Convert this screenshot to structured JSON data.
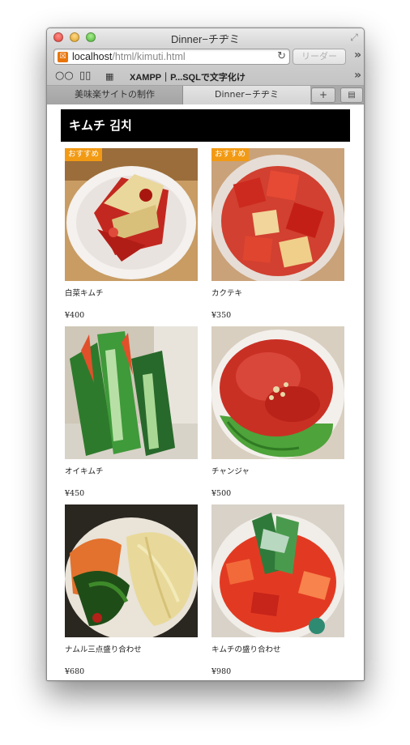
{
  "window": {
    "title": "Dinner−チヂミ"
  },
  "toolbar": {
    "url_host": "localhost",
    "url_path": "/html/kimuti.html",
    "reader_label": "リーダー"
  },
  "bookmarks": {
    "item": "XAMPP｜P...SQLで文字化け"
  },
  "tabs": [
    {
      "label": "美味楽サイトの制作"
    },
    {
      "label": "Dinner−チヂミ"
    }
  ],
  "page": {
    "heading": "キムチ 김치",
    "badge_label": "おすすめ",
    "items": [
      {
        "name": "白菜キムチ",
        "price": "¥400",
        "recommended": true,
        "photo": "napa-cabbage-kimchi"
      },
      {
        "name": "カクテキ",
        "price": "¥350",
        "recommended": true,
        "photo": "radish-kimchi"
      },
      {
        "name": "オイキムチ",
        "price": "¥450",
        "recommended": false,
        "photo": "cucumber-kimchi"
      },
      {
        "name": "チャンジャ",
        "price": "¥500",
        "recommended": false,
        "photo": "changja"
      },
      {
        "name": "ナムル三点盛り合わせ",
        "price": "¥680",
        "recommended": false,
        "photo": "namul-platter"
      },
      {
        "name": "キムチの盛り合わせ",
        "price": "¥980",
        "recommended": false,
        "photo": "kimchi-platter"
      }
    ]
  },
  "colors": {
    "badge": "#f29a14",
    "heading_bg": "#000000",
    "heading_text": "#ffffff"
  }
}
